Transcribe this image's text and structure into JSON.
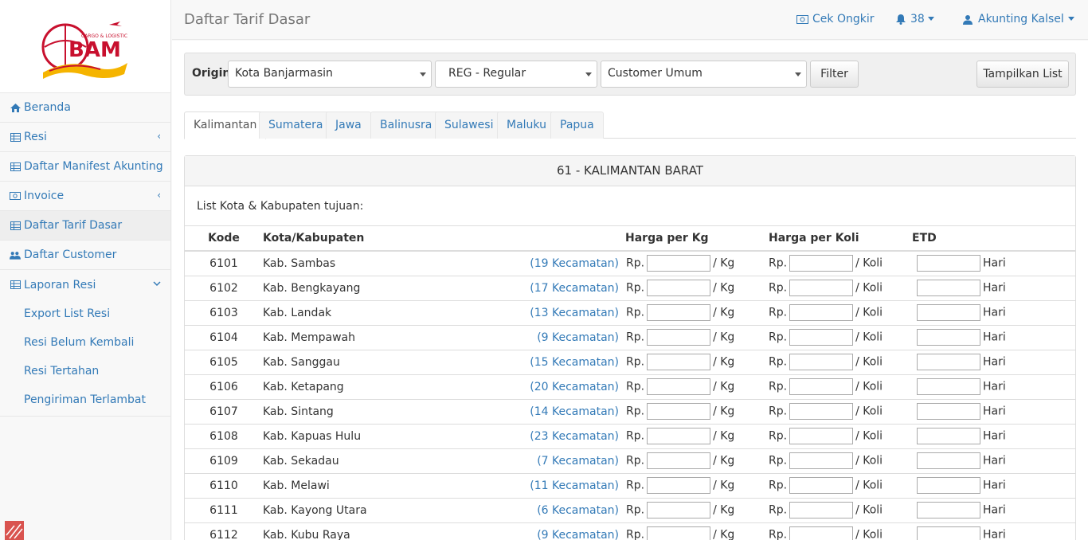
{
  "logo": {
    "text": "BAM",
    "tagline": "CARGO & LOGISTIC"
  },
  "sidebar": {
    "items": [
      {
        "label": "Beranda",
        "icon": "home-icon"
      },
      {
        "label": "Resi",
        "icon": "table-icon"
      },
      {
        "label": "Daftar Manifest Akunting",
        "icon": "table-icon"
      },
      {
        "label": "Invoice",
        "icon": "money-icon"
      },
      {
        "label": "Daftar Tarif Dasar",
        "icon": "table-icon"
      },
      {
        "label": "Daftar Customer",
        "icon": "users-icon"
      },
      {
        "label": "Laporan Resi",
        "icon": "table-icon"
      }
    ],
    "sub_items": [
      "Export List Resi",
      "Resi Belum Kembali",
      "Resi Tertahan",
      "Pengiriman Terlambat"
    ]
  },
  "header": {
    "title": "Daftar Tarif Dasar",
    "cek_ongkir": "Cek Ongkir",
    "notif_count": "38",
    "user": "Akunting Kalsel"
  },
  "filter": {
    "origin_label": "Origin",
    "origin_value": "Kota Banjarmasin",
    "service_value": "REG - Regular",
    "customer_value": "Customer Umum",
    "filter_button": "Filter",
    "show_list_button": "Tampilkan List"
  },
  "tabs": [
    "Kalimantan",
    "Sumatera",
    "Jawa",
    "Balinusra",
    "Sulawesi",
    "Maluku",
    "Papua"
  ],
  "panel": {
    "title": "61 - KALIMANTAN BARAT",
    "subtitle": "List Kota & Kabupaten tujuan:"
  },
  "table": {
    "headers": {
      "kode": "Kode",
      "kota": "Kota/Kabupaten",
      "kg": "Harga per Kg",
      "koli": "Harga per Koli",
      "etd": "ETD"
    },
    "rp": "Rp.",
    "per_kg": "/ Kg",
    "per_koli": "/ Koli",
    "hari": "Hari",
    "rows": [
      {
        "kode": "6101",
        "kota": "Kab. Sambas",
        "kec": "(19 Kecamatan)"
      },
      {
        "kode": "6102",
        "kota": "Kab. Bengkayang",
        "kec": "(17 Kecamatan)"
      },
      {
        "kode": "6103",
        "kota": "Kab. Landak",
        "kec": "(13 Kecamatan)"
      },
      {
        "kode": "6104",
        "kota": "Kab. Mempawah",
        "kec": "(9 Kecamatan)"
      },
      {
        "kode": "6105",
        "kota": "Kab. Sanggau",
        "kec": "(15 Kecamatan)"
      },
      {
        "kode": "6106",
        "kota": "Kab. Ketapang",
        "kec": "(20 Kecamatan)"
      },
      {
        "kode": "6107",
        "kota": "Kab. Sintang",
        "kec": "(14 Kecamatan)"
      },
      {
        "kode": "6108",
        "kota": "Kab. Kapuas Hulu",
        "kec": "(23 Kecamatan)"
      },
      {
        "kode": "6109",
        "kota": "Kab. Sekadau",
        "kec": "(7 Kecamatan)"
      },
      {
        "kode": "6110",
        "kota": "Kab. Melawi",
        "kec": "(11 Kecamatan)"
      },
      {
        "kode": "6111",
        "kota": "Kab. Kayong Utara",
        "kec": "(6 Kecamatan)"
      },
      {
        "kode": "6112",
        "kota": "Kab. Kubu Raya",
        "kec": "(9 Kecamatan)"
      }
    ]
  },
  "colors": {
    "link": "#337ab7",
    "logo_red": "#c8102e",
    "logo_yellow": "#f5b400"
  }
}
